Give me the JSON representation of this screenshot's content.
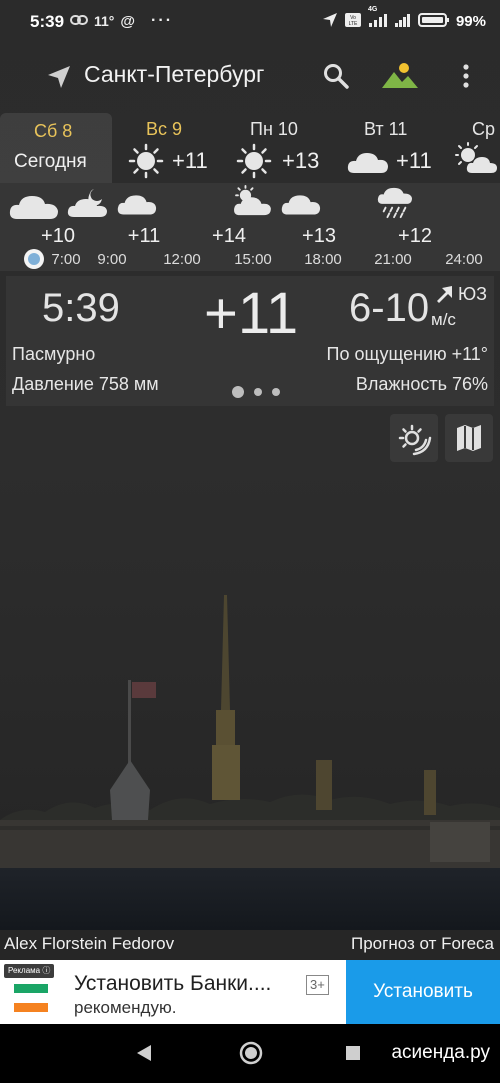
{
  "status_bar": {
    "time": "5:39",
    "temp": "11°",
    "dots": "···",
    "network": "4G",
    "battery": "99%"
  },
  "header": {
    "city": "Санкт-Петербург"
  },
  "days": [
    {
      "name": "Сб 8",
      "sub": "Сегодня",
      "active": true,
      "color": "#e8c35a"
    },
    {
      "name": "Вс 9",
      "temp": "+11",
      "icon": "sun-icon",
      "color": "#e8c35a"
    },
    {
      "name": "Пн 10",
      "temp": "+13",
      "icon": "sun-icon",
      "color": "#e6e6e6"
    },
    {
      "name": "Вт 11",
      "temp": "+11",
      "icon": "cloud-icon",
      "color": "#e6e6e6"
    },
    {
      "name": "Ср",
      "icon": "partly-cloudy-icon",
      "color": "#e6e6e6"
    }
  ],
  "hourly": [
    {
      "temp": "+10",
      "time": "7:00",
      "icon": "cloud-icon"
    },
    {
      "temp": "+11",
      "time": "9:00",
      "icon": "partly-cloudy-night-icon"
    },
    {
      "temp": "+14",
      "time": "12:00",
      "icon": "cloud-icon"
    },
    {
      "temp": "+13",
      "time": "15:00",
      "icon": "partly-cloudy-icon"
    },
    {
      "temp": "+12",
      "time": "18:00",
      "icon": "cloud-icon"
    },
    {
      "temp": "",
      "time": "21:00",
      "icon": "rain-icon"
    },
    {
      "temp": "",
      "time": "24:00",
      "icon": ""
    }
  ],
  "current": {
    "time": "5:39",
    "temp": "+11",
    "wind_speed": "6-10",
    "wind_dir": "ЮЗ",
    "wind_unit": "м/с",
    "condition": "Пасмурно",
    "feels_like": "По ощущению +11°",
    "pressure": "Давление 758 мм",
    "humidity": "Влажность 76%"
  },
  "credits": {
    "photo": "Alex Florstein Fedorov",
    "forecast": "Прогноз от Foreca"
  },
  "ad": {
    "badge": "Реклама",
    "title": "Установить Банки....",
    "subtitle": "рекомендую.",
    "rating": "3+",
    "install": "Установить"
  },
  "watermark": "асиенда.ру",
  "colors": {
    "accent_day": "#e8c35a",
    "install_button": "#1a9be9",
    "now_dot": "#7fb0d8"
  }
}
